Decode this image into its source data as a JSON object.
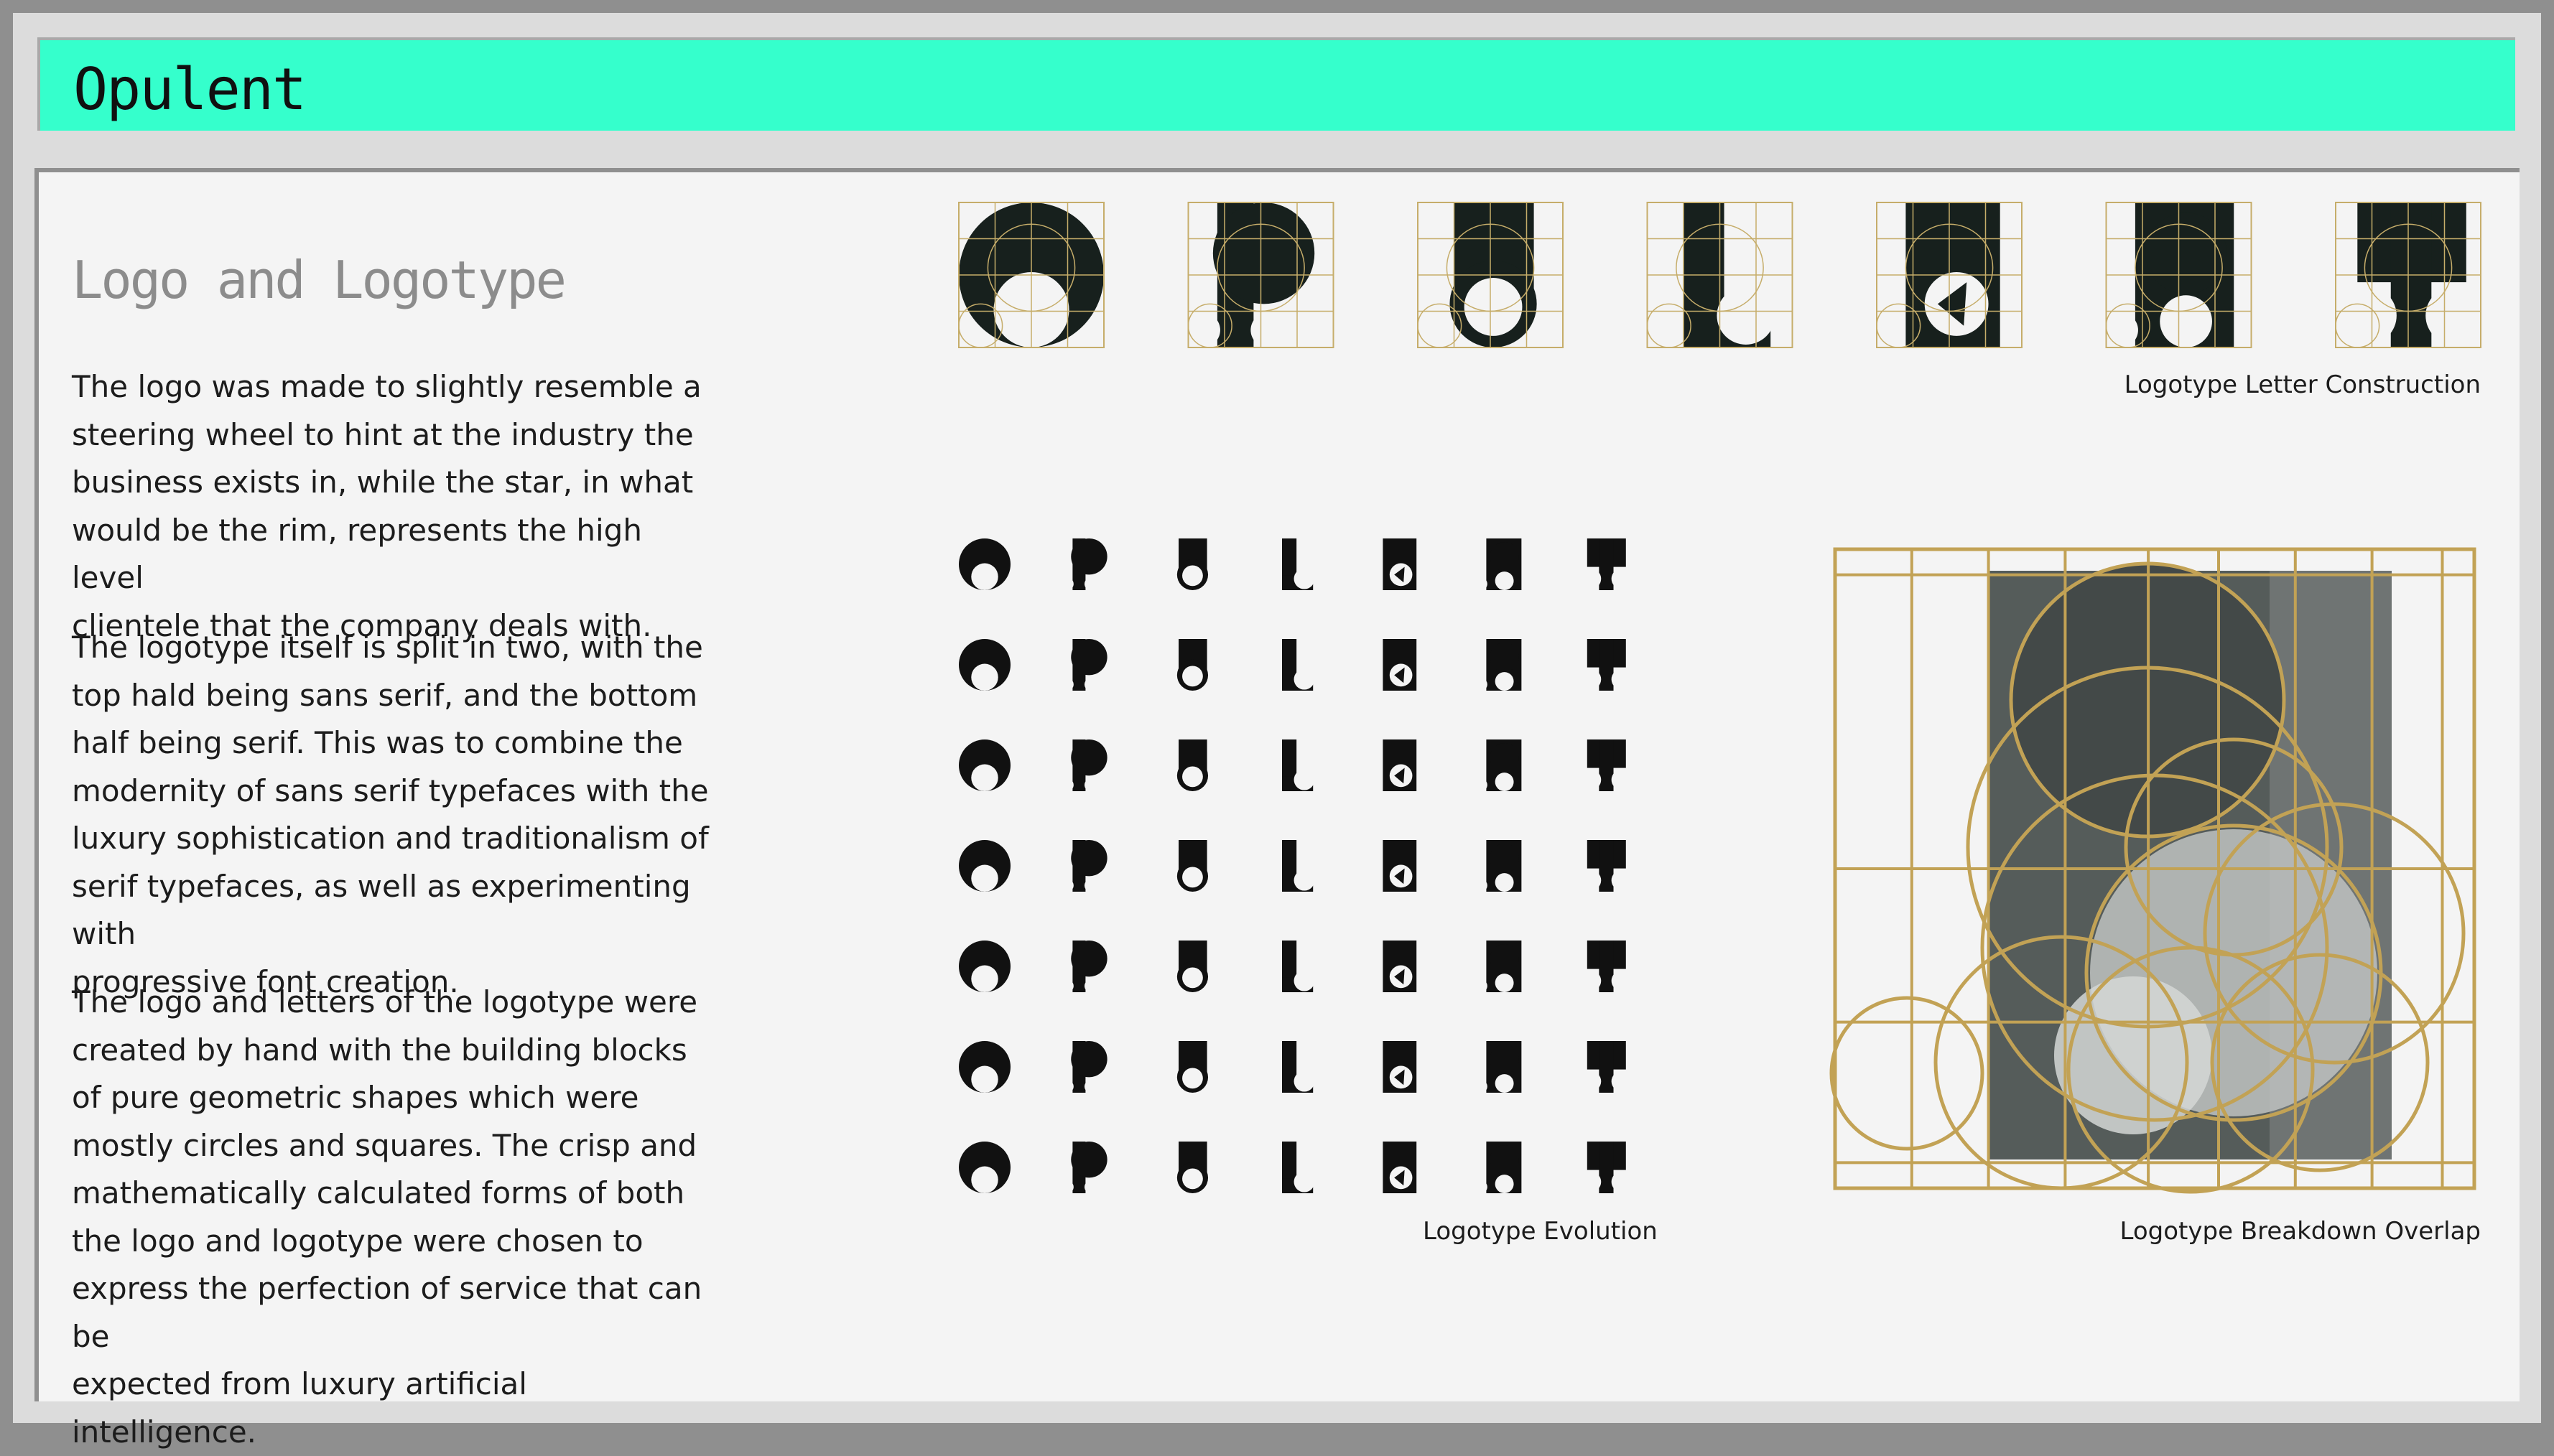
{
  "header": {
    "title": "Opulent"
  },
  "section": {
    "title": "Logo and Logotype",
    "paragraphs": [
      [
        "The logo was made to slightly resemble a",
        "steering wheel to hint at the industry the",
        "business exists in, while the star, in what",
        "would be the rim, represents the high level",
        "clientele that the company deals with."
      ],
      [
        "The logotype itself is split in two, with the",
        "top hald being sans serif, and the bottom",
        "half being serif. This was to combine the",
        "modernity of sans serif typefaces with the",
        "luxury sophistication and traditionalism of",
        "serif typefaces, as well as experimenting with",
        "progressive font creation."
      ],
      [
        "The logo and letters of the logotype were",
        "created by hand with the building blocks",
        "of pure geometric shapes which were",
        "mostly circles and squares. The crisp and",
        "mathematically calculated forms of both",
        "the logo and logotype were chosen to",
        "express the perfection of service that can be",
        "expected from luxury artificial intelligence."
      ]
    ]
  },
  "figures": {
    "construction_caption": "Logotype Letter Construction",
    "evolution_caption": "Logotype Evolution",
    "overlap_caption": "Logotype Breakdown Overlap",
    "letters": [
      "O",
      "P",
      "U",
      "L",
      "E",
      "N",
      "T"
    ]
  },
  "colors": {
    "accent": "#35ffcc",
    "glyph": "#17201d",
    "grid": "#c6ad6a",
    "overlap_grid": "#c2a255",
    "overlap_fill": "#4c5351"
  }
}
